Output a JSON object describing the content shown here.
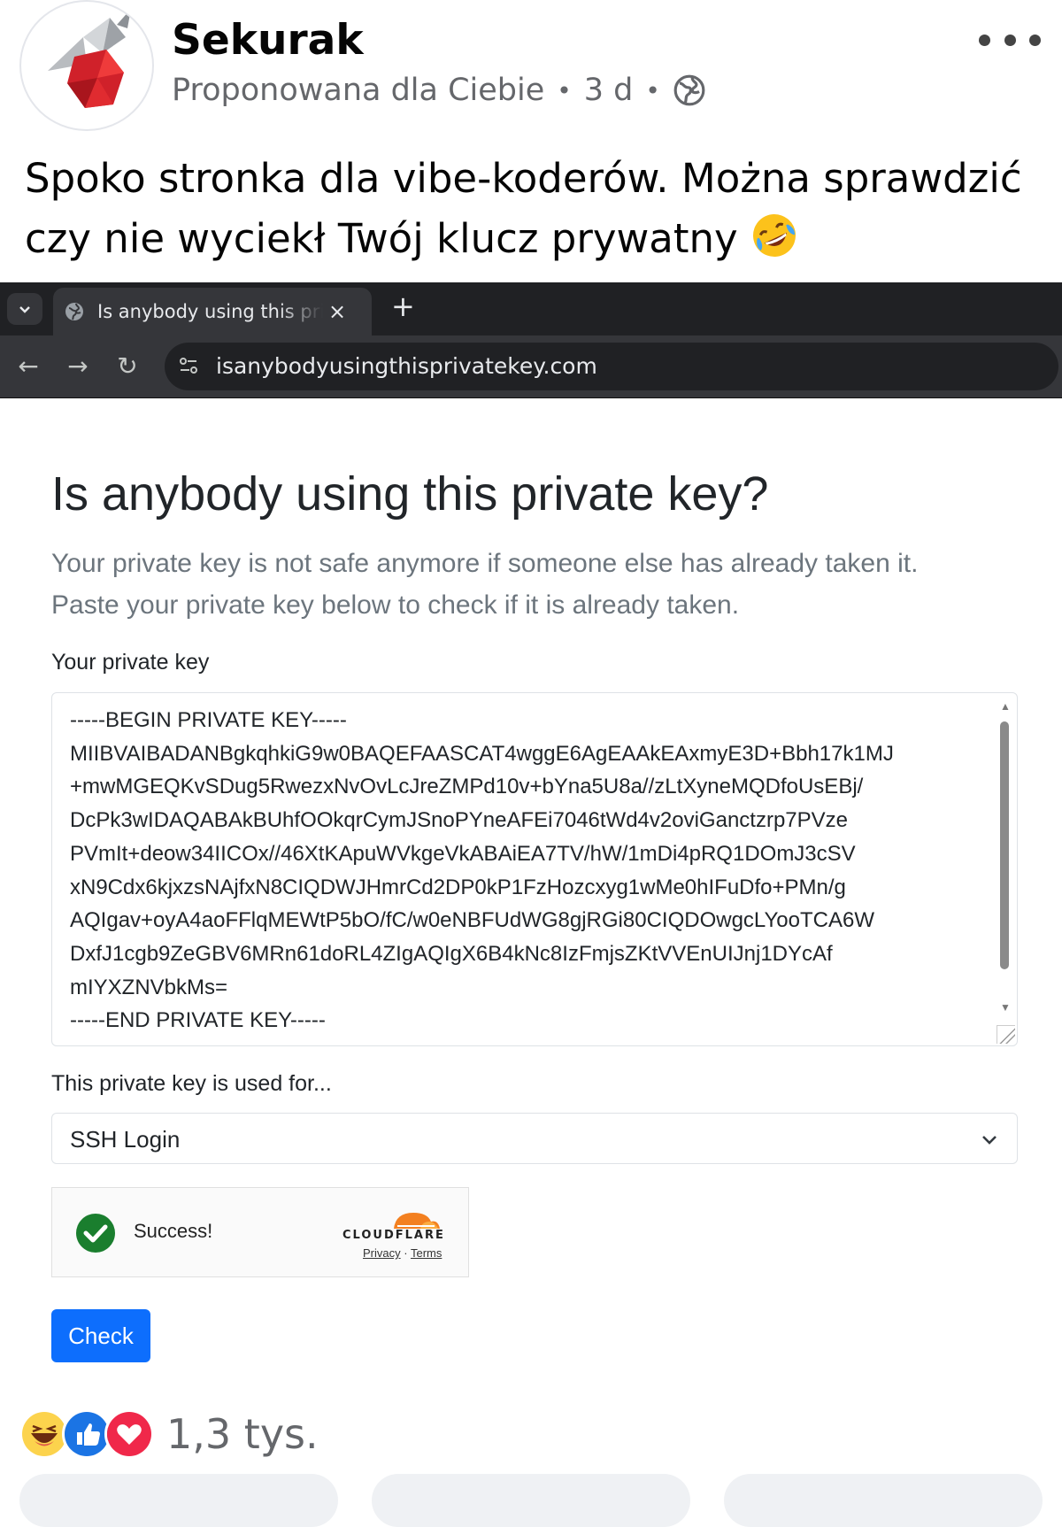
{
  "post": {
    "page_name": "Sekurak",
    "suggested_label": "Proponowana dla Ciebie",
    "separator": "•",
    "age": "3 d",
    "text_line1": "Spoko stronka dla vibe-koderów. Można sprawdzić",
    "text_line2": "czy nie wyciekł Twój klucz prywatny",
    "emoji": "rolling-on-floor-laughing-emoji"
  },
  "browser": {
    "tab_title": "Is anybody using this private key?",
    "tab_close": "×",
    "new_tab": "+",
    "url": "isanybodyusingthisprivatekey.com",
    "back": "←",
    "forward": "→",
    "reload": "↻"
  },
  "page": {
    "title": "Is anybody using this private key?",
    "lead_line1": "Your private key is not safe anymore if someone else has already taken it.",
    "lead_line2": "Paste your private key below to check if it is already taken.",
    "key_label": "Your private key",
    "key_lines": [
      "-----BEGIN PRIVATE KEY-----",
      "MIIBVAIBADANBgkqhkiG9w0BAQEFAASCAT4wggE6AgEAAkEAxmyE3D+Bbh17k1MJ",
      "+mwMGEQKvSDug5RwezxNvOvLcJreZMPd10v+bYna5U8a//zLtXyneMQDfoUsEBj/",
      "DcPk3wIDAQABAkBUhfOOkqrCymJSnoPYneAFEi7046tWd4v2oviGanctzrp7PVze",
      "PVmIt+deow34IICOx//46XtKApuWVkgeVkABAiEA7TV/hW/1mDi4pRQ1DOmJ3cSV",
      "xN9Cdx6kjxzsNAjfxN8CIQDWJHmrCd2DP0kP1FzHozcxyg1wMe0hIFuDfo+PMn/g",
      "AQIgav+oyA4aoFFlqMEWtP5bO/fC/w0eNBFUdWG8gjRGi80CIQDOwgcLYooTCA6W",
      "DxfJ1cgb9ZeGBV6MRn61doRL4ZIgAQIgX6B4kNc8IzFmjsZKtVVEnUIJnj1DYcAf",
      "mIYXZNVbkMs=",
      "-----END PRIVATE KEY-----"
    ],
    "usage_label": "This private key is used for...",
    "usage_value": "SSH Login",
    "captcha_status": "Success!",
    "captcha_brand": "CLOUDFLARE",
    "captcha_privacy": "Privacy",
    "captcha_dot": "·",
    "captcha_terms": "Terms",
    "check_label": "Check"
  },
  "reactions": {
    "types": [
      "haha",
      "like",
      "love"
    ],
    "count": "1,3 tys."
  },
  "colors": {
    "check_button": "#0d6efd",
    "success_green": "#1a7e2e",
    "cloudflare_orange": "#f38020",
    "browser_dark": "#202124"
  }
}
